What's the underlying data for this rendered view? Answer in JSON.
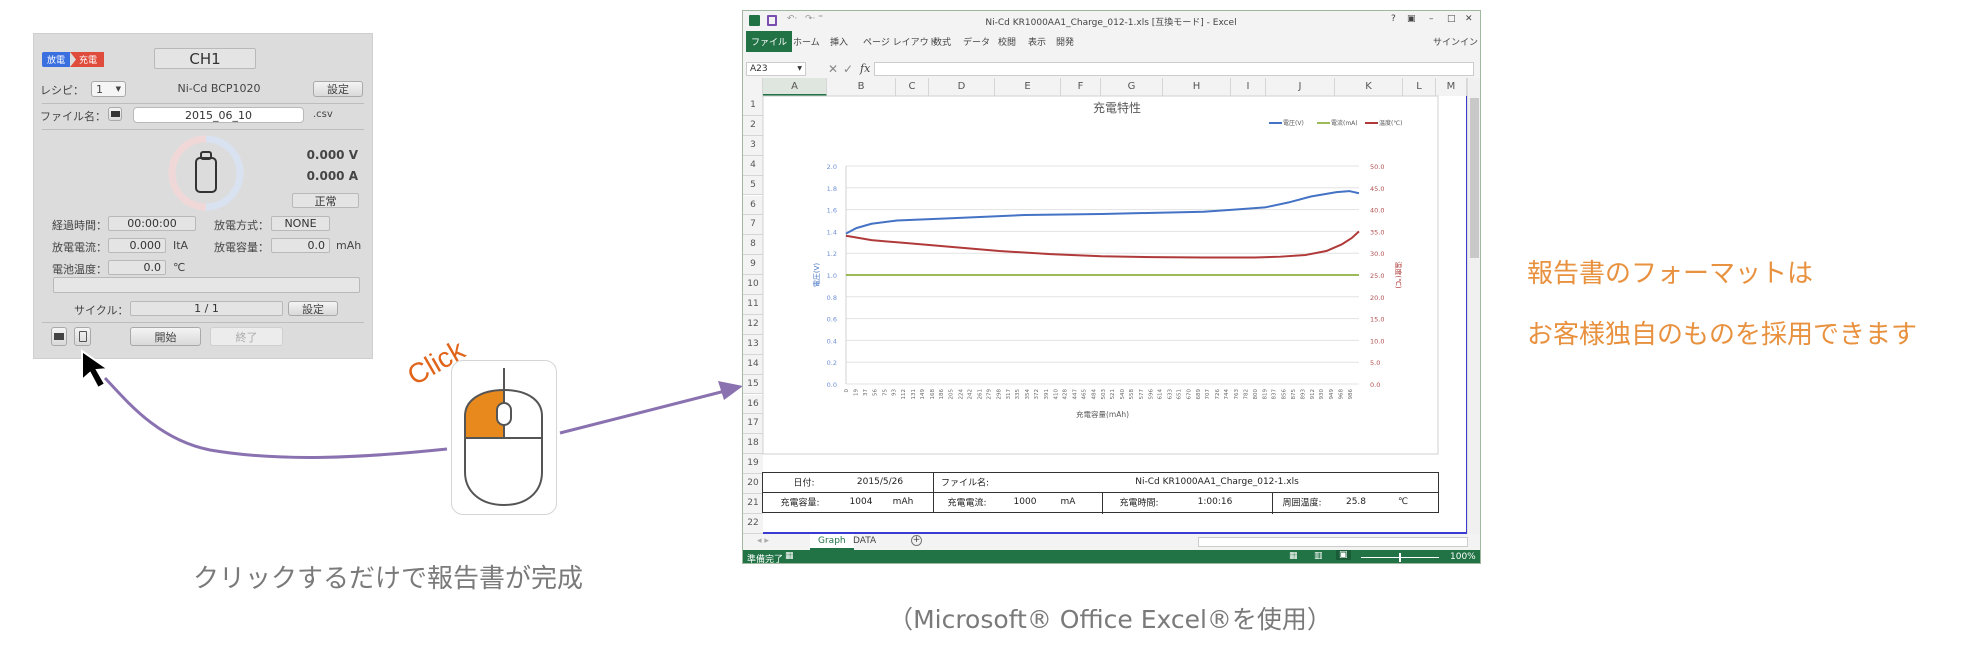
{
  "panel": {
    "mode_badge": {
      "discharge": "放電",
      "charge": "充電"
    },
    "channel": "CH1",
    "recipe_label": "レシピ：",
    "recipe_value": "1",
    "battery_name": "Ni-Cd BCP1020",
    "settings_label": "設定",
    "file_label": "ファイル名：",
    "file_value": "2015_06_10",
    "file_ext": ".csv",
    "voltage": "0.000 V",
    "current": "0.000 A",
    "status": "正常",
    "elapsed_label": "経過時間：",
    "elapsed_value": "00:00:00",
    "discharge_mode_label": "放電方式：",
    "discharge_mode_value": "NONE",
    "discharge_current_label": "放電電流：",
    "discharge_current_value": "0.000",
    "discharge_current_unit": "ItA",
    "discharge_capacity_label": "放電容量：",
    "discharge_capacity_value": "0.0",
    "discharge_capacity_unit": "mAh",
    "battery_temp_label": "電池温度：",
    "battery_temp_value": "0.0",
    "battery_temp_unit": "℃",
    "progress": 0,
    "cycle_label": "サイクル：",
    "cycle_value": "1 / 1",
    "cycle_settings_label": "設定",
    "start_label": "開始",
    "stop_label": "終了"
  },
  "annotations": {
    "click_label": "Click",
    "left_caption": "クリックするだけで報告書が完成",
    "excel_caption": "（Microsoft® Office Excel®を使用）",
    "right_line1": "報告書のフォーマットは",
    "right_line2": "お客様独自のものを採用できます",
    "accent_orange": "#e8913f",
    "click_color": "#e0641a",
    "arrow_color": "#8a72b0"
  },
  "excel": {
    "title": "Ni-Cd KR1000AA1_Charge_012-1.xls  [互換モード] - Excel",
    "window_controls": [
      "?",
      "▣",
      "–",
      "□",
      "✕"
    ],
    "ribbon_tabs": [
      "ファイル",
      "ホーム",
      "挿入",
      "ページ レイアウト",
      "数式",
      "データ",
      "校閲",
      "表示",
      "開発"
    ],
    "signin": "サインイン",
    "name_box": "A23",
    "fx": "fx",
    "columns": [
      "A",
      "B",
      "C",
      "D",
      "E",
      "F",
      "G",
      "H",
      "I",
      "J",
      "K",
      "L",
      "M"
    ],
    "rows": [
      "1",
      "2",
      "3",
      "4",
      "5",
      "6",
      "7",
      "8",
      "9",
      "10",
      "11",
      "12",
      "13",
      "14",
      "15",
      "16",
      "17",
      "18",
      "19",
      "20",
      "21",
      "22"
    ],
    "report": {
      "date_label": "日付:",
      "date_value": "2015/5/26",
      "file_label": "ファイル名:",
      "file_value": "Ni-Cd KR1000AA1_Charge_012-1.xls",
      "capacity_label": "充電容量:",
      "capacity_value": "1004",
      "capacity_unit": "mAh",
      "current_label": "充電電流:",
      "current_value": "1000",
      "current_unit": "mA",
      "time_label": "充電時間:",
      "time_value": "1:00:16",
      "ambient_label": "周囲温度:",
      "ambient_value": "25.8",
      "ambient_unit": "℃"
    },
    "sheet_tabs": [
      "Graph",
      "DATA"
    ],
    "active_sheet": "Graph",
    "status": "準備完了",
    "zoom": "100%"
  },
  "chart_data": {
    "type": "line",
    "title": "充電特性",
    "xlabel": "充電容量(mAh)",
    "ylabel": "電圧(V)",
    "y2label": "温度(℃)",
    "x_ticks": [
      0,
      19,
      37,
      56,
      75,
      93,
      112,
      131,
      149,
      168,
      186,
      205,
      224,
      242,
      261,
      279,
      298,
      317,
      335,
      354,
      372,
      391,
      410,
      428,
      447,
      465,
      484,
      503,
      521,
      540,
      558,
      577,
      596,
      614,
      633,
      651,
      670,
      689,
      707,
      726,
      744,
      763,
      782,
      800,
      819,
      837,
      856,
      875,
      893,
      912,
      930,
      949,
      968,
      986
    ],
    "xlim": [
      0,
      1004
    ],
    "ylim": [
      0,
      2.0
    ],
    "y_ticks": [
      "0.0",
      "0.2",
      "0.4",
      "0.6",
      "0.8",
      "1.0",
      "1.2",
      "1.4",
      "1.6",
      "1.8",
      "2.0"
    ],
    "y2lim": [
      0,
      50
    ],
    "y2_ticks": [
      "0.0",
      "5.0",
      "10.0",
      "15.0",
      "20.0",
      "25.0",
      "30.0",
      "35.0",
      "40.0",
      "45.0",
      "50.0"
    ],
    "grid": true,
    "legend": "top-right",
    "series": [
      {
        "name": "電圧(V)",
        "axis": "left",
        "color": "#4472c4",
        "x": [
          0,
          20,
          50,
          100,
          200,
          350,
          500,
          600,
          700,
          760,
          820,
          870,
          910,
          960,
          985,
          1004
        ],
        "y": [
          1.38,
          1.43,
          1.47,
          1.5,
          1.52,
          1.55,
          1.56,
          1.57,
          1.58,
          1.6,
          1.62,
          1.67,
          1.72,
          1.76,
          1.77,
          1.75
        ]
      },
      {
        "name": "電流(mA)",
        "axis": "left",
        "color": "#9bbb59",
        "x": [
          0,
          1004
        ],
        "y": [
          1.0,
          1.0
        ]
      },
      {
        "name": "温度(℃)",
        "axis": "right",
        "color": "#b03a3a",
        "x": [
          0,
          50,
          120,
          200,
          300,
          400,
          500,
          600,
          700,
          800,
          850,
          900,
          940,
          970,
          990,
          1004
        ],
        "y": [
          34.0,
          33.0,
          32.3,
          31.5,
          30.5,
          29.8,
          29.3,
          29.1,
          29.0,
          29.0,
          29.2,
          29.6,
          30.5,
          32.0,
          33.5,
          35.0
        ]
      }
    ]
  }
}
